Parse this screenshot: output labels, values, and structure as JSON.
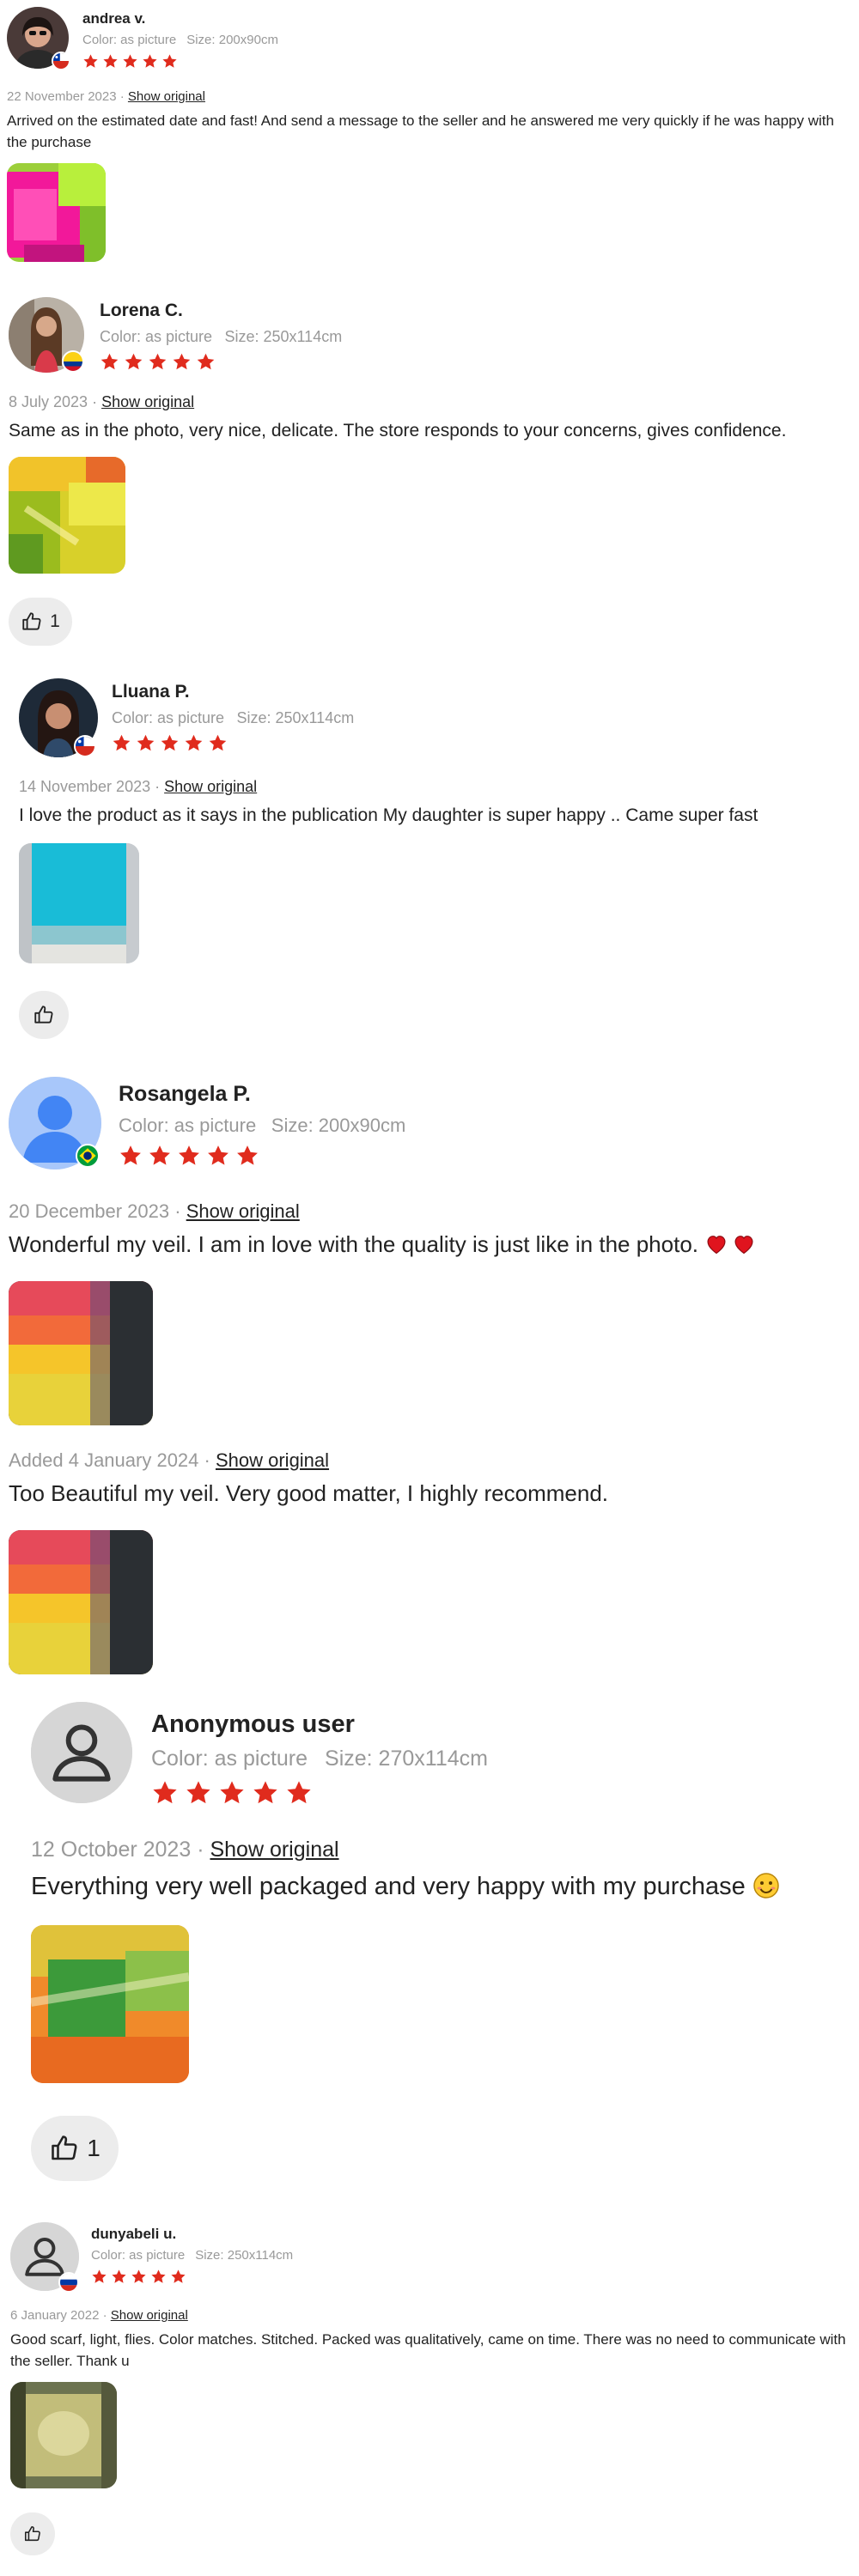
{
  "colors": {
    "star": "#e02b1d",
    "muted": "#999999",
    "text": "#222222",
    "button_bg": "#ececec"
  },
  "reviews": [
    {
      "name": "andrea v.",
      "color": "Color: as picture",
      "size": "Size: 200x90cm",
      "rating": 5,
      "date": "22 November 2023 ·",
      "show_original": "Show original",
      "text": "Arrived on the estimated date and fast! And send a message to the seller and he answered me very quickly if he was happy with the purchase",
      "flag": "chile"
    },
    {
      "name": "Lorena C.",
      "color": "Color: as picture",
      "size": "Size: 250x114cm",
      "rating": 5,
      "date": "8 July 2023 ·",
      "show_original": "Show original",
      "text": "Same as in the photo, very nice, delicate. The store responds to your concerns, gives confidence.",
      "helpful_count": "1",
      "flag": "colombia"
    },
    {
      "name": "Lluana P.",
      "color": "Color: as picture",
      "size": "Size: 250x114cm",
      "rating": 5,
      "date": "14 November 2023 ·",
      "show_original": "Show original",
      "text": "I love the product as it says in the publication My daughter is super happy .. Came super fast",
      "flag": "chile"
    },
    {
      "name": "Rosangela P.",
      "color": "Color: as picture",
      "size": "Size: 200x90cm",
      "rating": 5,
      "date": "20 December 2023 ·",
      "show_original": "Show original",
      "text": "Wonderful my veil. I am in love with the quality is just like in the photo.",
      "followup_date": "Added 4 January 2024 ·",
      "followup_show_original": "Show original",
      "followup_text": "Too Beautiful my veil. Very good matter, I highly recommend.",
      "flag": "brazil"
    },
    {
      "name": "Anonymous user",
      "color": "Color: as picture",
      "size": "Size: 270x114cm",
      "rating": 5,
      "date": "12 October 2023 ·",
      "show_original": "Show original",
      "text": "Everything very well packaged and very happy with my purchase",
      "helpful_count": "1"
    },
    {
      "name": "dunyabeli u.",
      "color": "Color: as picture",
      "size": "Size: 250x114cm",
      "rating": 5,
      "date": "6 January 2022 ·",
      "show_original": "Show original",
      "text": "Good scarf, light, flies. Color matches. Stitched. Packed was qualitatively, came on time. There was no need to communicate with the seller. Thank u",
      "flag": "russia"
    }
  ]
}
